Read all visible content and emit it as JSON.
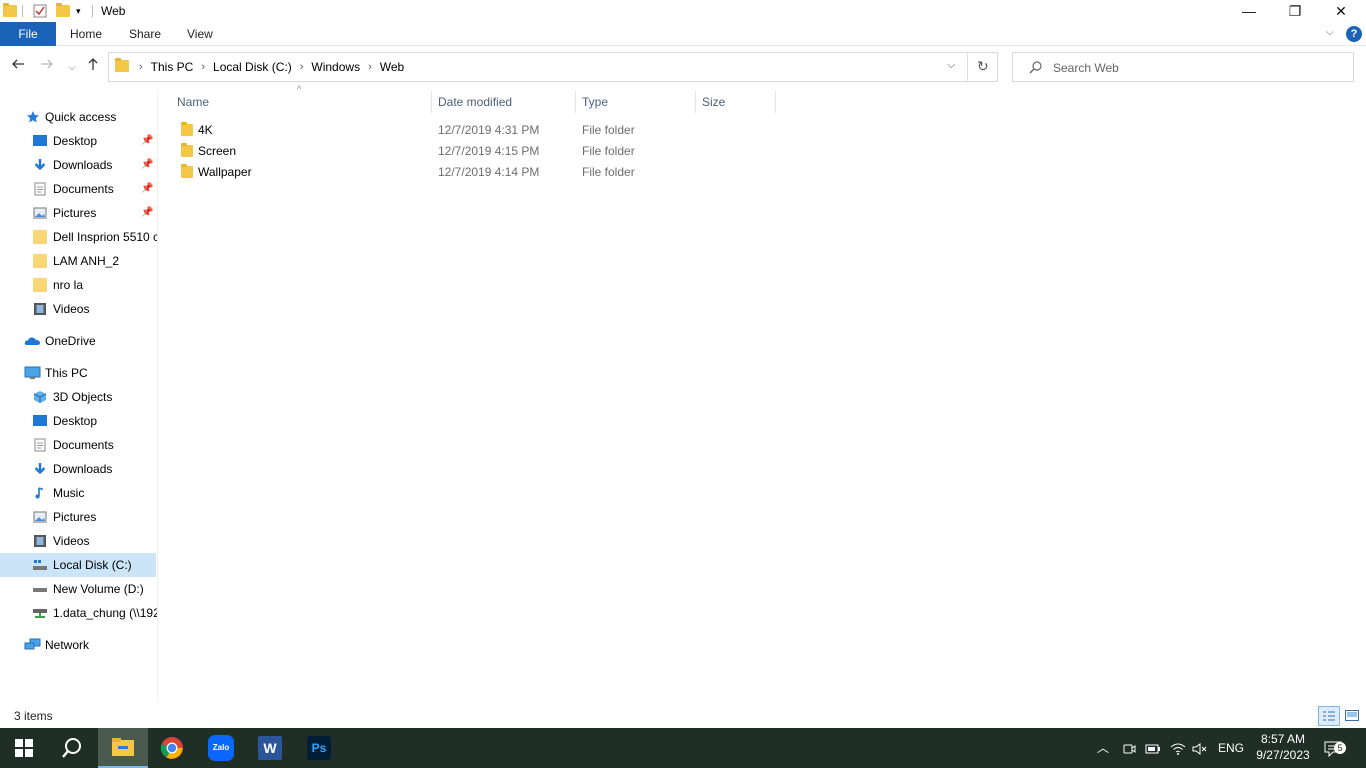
{
  "window": {
    "title": "Web",
    "buttons": {
      "minimize": "—",
      "restore": "❐",
      "close": "✕"
    }
  },
  "ribbon": {
    "tabs": [
      "File",
      "Home",
      "Share",
      "View"
    ],
    "help": "?"
  },
  "address": {
    "crumbs": [
      "This PC",
      "Local Disk (C:)",
      "Windows",
      "Web"
    ],
    "search_placeholder": "Search Web"
  },
  "sidebar": {
    "quick_access": "Quick access",
    "quick_items": [
      {
        "label": "Desktop",
        "icon": "desktop-icon",
        "pinned": true
      },
      {
        "label": "Downloads",
        "icon": "downloads-icon",
        "pinned": true
      },
      {
        "label": "Documents",
        "icon": "documents-icon",
        "pinned": true
      },
      {
        "label": "Pictures",
        "icon": "pictures-icon",
        "pinned": true
      },
      {
        "label": "Dell Insprion 5510 c",
        "icon": "folder-icon",
        "pinned": false
      },
      {
        "label": "LAM ANH_2",
        "icon": "folder-icon",
        "pinned": false
      },
      {
        "label": "nro la",
        "icon": "folder-icon",
        "pinned": false
      },
      {
        "label": "Videos",
        "icon": "videos-icon",
        "pinned": false
      }
    ],
    "onedrive": "OneDrive",
    "this_pc": "This PC",
    "pc_items": [
      {
        "label": "3D Objects",
        "icon": "3d-objects-icon"
      },
      {
        "label": "Desktop",
        "icon": "desktop-icon"
      },
      {
        "label": "Documents",
        "icon": "documents-icon"
      },
      {
        "label": "Downloads",
        "icon": "downloads-icon"
      },
      {
        "label": "Music",
        "icon": "music-icon"
      },
      {
        "label": "Pictures",
        "icon": "pictures-icon"
      },
      {
        "label": "Videos",
        "icon": "videos-icon"
      },
      {
        "label": "Local Disk (C:)",
        "icon": "drive-icon",
        "active": true
      },
      {
        "label": "New Volume (D:)",
        "icon": "drive-icon"
      },
      {
        "label": "1.data_chung (\\\\192",
        "icon": "network-drive-icon"
      }
    ],
    "network": "Network"
  },
  "columns": [
    "Name",
    "Date modified",
    "Type",
    "Size"
  ],
  "files": [
    {
      "name": "4K",
      "date": "12/7/2019 4:31 PM",
      "type": "File folder",
      "size": ""
    },
    {
      "name": "Screen",
      "date": "12/7/2019 4:15 PM",
      "type": "File folder",
      "size": ""
    },
    {
      "name": "Wallpaper",
      "date": "12/7/2019 4:14 PM",
      "type": "File folder",
      "size": ""
    }
  ],
  "status": {
    "item_count": "3 items"
  },
  "taskbar": {
    "apps": [
      "start-icon",
      "search-icon",
      "file-explorer-icon",
      "chrome-icon",
      "zalo-icon",
      "word-icon",
      "photoshop-icon"
    ],
    "zalo_label": "Zalo",
    "word_label": "W",
    "ps_label": "Ps",
    "language": "ENG",
    "time": "8:57 AM",
    "date": "9/27/2023",
    "notifications": "5"
  }
}
